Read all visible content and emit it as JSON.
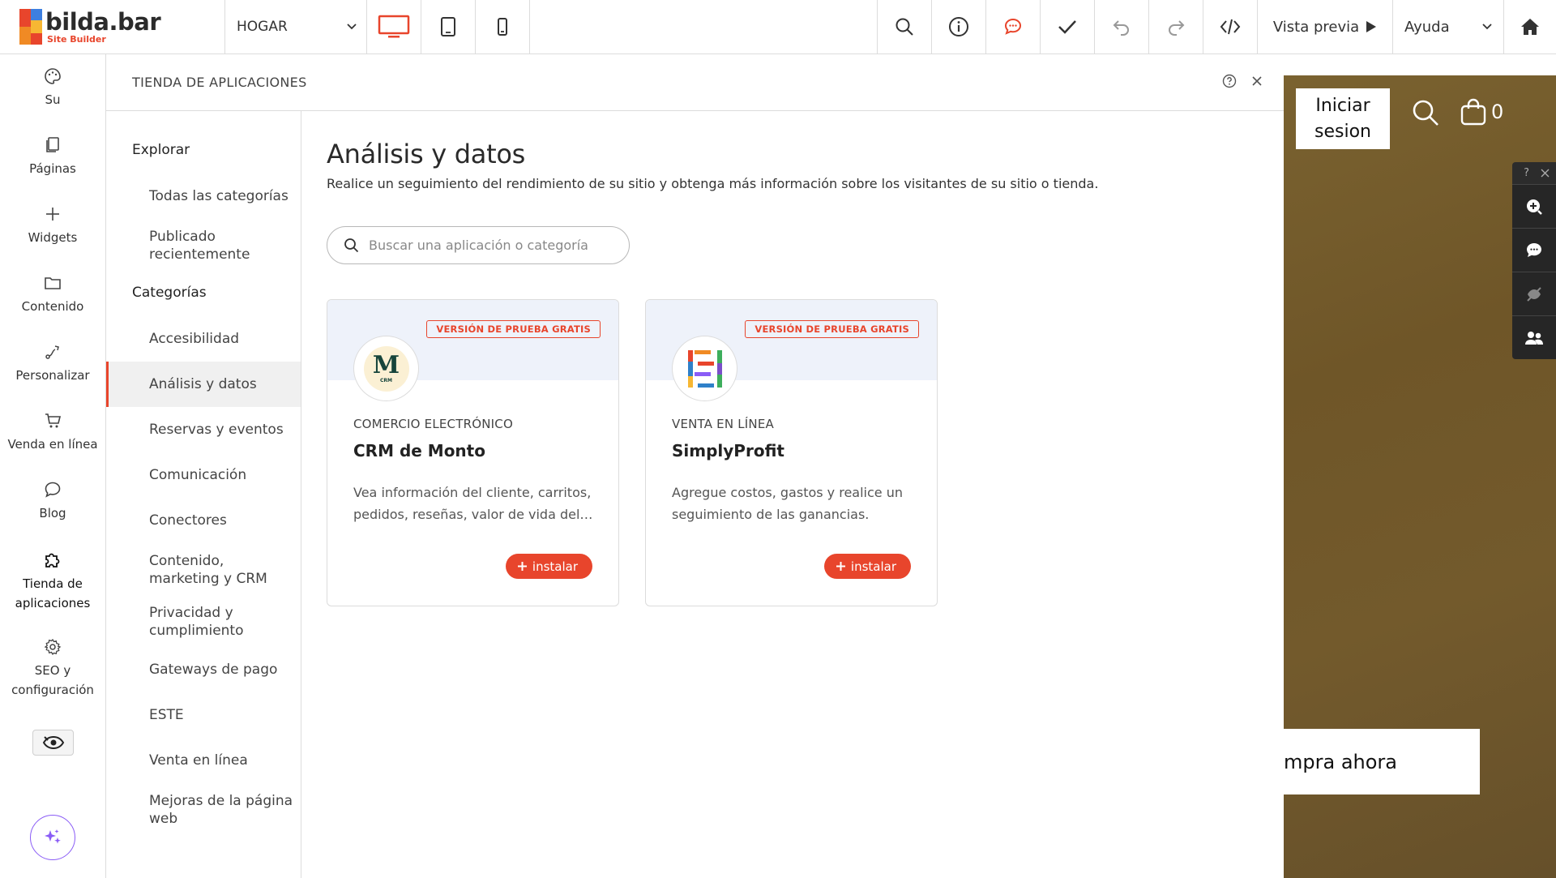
{
  "topbar": {
    "logo_title": "bilda.bar",
    "logo_sub": "Site Builder",
    "page_select": "HOGAR",
    "preview_label": "Vista previa",
    "help_label": "Ayuda"
  },
  "sidebar": {
    "items": [
      {
        "label": "Su",
        "icon": "palette-icon"
      },
      {
        "label": "Páginas",
        "icon": "pages-icon"
      },
      {
        "label": "Widgets",
        "icon": "plus-icon"
      },
      {
        "label": "Contenido",
        "icon": "folder-icon"
      },
      {
        "label": "Personalizar",
        "icon": "customize-icon"
      },
      {
        "label": "Venda en línea",
        "icon": "cart-icon"
      },
      {
        "label": "Blog",
        "icon": "chat-icon"
      },
      {
        "label": "Tienda de aplicaciones",
        "icon": "puzzle-icon"
      },
      {
        "label": "SEO y configuración",
        "icon": "gear-icon"
      }
    ]
  },
  "panel": {
    "title": "TIENDA DE APLICACIONES",
    "nav": {
      "explore_heading": "Explorar",
      "explore_items": [
        "Todas las categorías",
        "Publicado recientemente"
      ],
      "categories_heading": "Categorías",
      "category_items": [
        "Accesibilidad",
        "Análisis y datos",
        "Reservas y eventos",
        "Comunicación",
        "Conectores",
        "Contenido, marketing y CRM",
        "Privacidad y cumplimiento",
        "Gateways de pago",
        "ESTE",
        "Venta en línea",
        "Mejoras de la página web"
      ],
      "active_category": "Análisis y datos"
    },
    "content": {
      "heading": "Análisis y datos",
      "description": "Realice un seguimiento del rendimiento de su sitio y obtenga más información sobre los visitantes de su sitio o tienda.",
      "search_placeholder": "Buscar una aplicación o categoría",
      "apps": [
        {
          "badge": "VERSIÓN DE PRUEBA GRATIS",
          "category": "COMERCIO ELECTRÓNICO",
          "name": "CRM de Monto",
          "description": "Vea información del cliente, carritos, pedidos, reseñas, valor de vida del cliente y más.",
          "install_label": "instalar",
          "logo_letter": "M",
          "logo_sub": "CRM"
        },
        {
          "badge": "VERSIÓN DE PRUEBA GRATIS",
          "category": "VENTA EN LÍNEA",
          "name": "SimplyProfit",
          "description": "Agregue costos, gastos y realice un seguimiento de las ganancias.",
          "install_label": "instalar"
        }
      ]
    }
  },
  "preview": {
    "login_label": "Iniciar sesion",
    "cart_count": "0",
    "buy_label": "mpra ahora"
  },
  "colors": {
    "accent": "#e8452c",
    "ai_purple": "#8a5cf6",
    "preview_bg": "#735a2c"
  }
}
